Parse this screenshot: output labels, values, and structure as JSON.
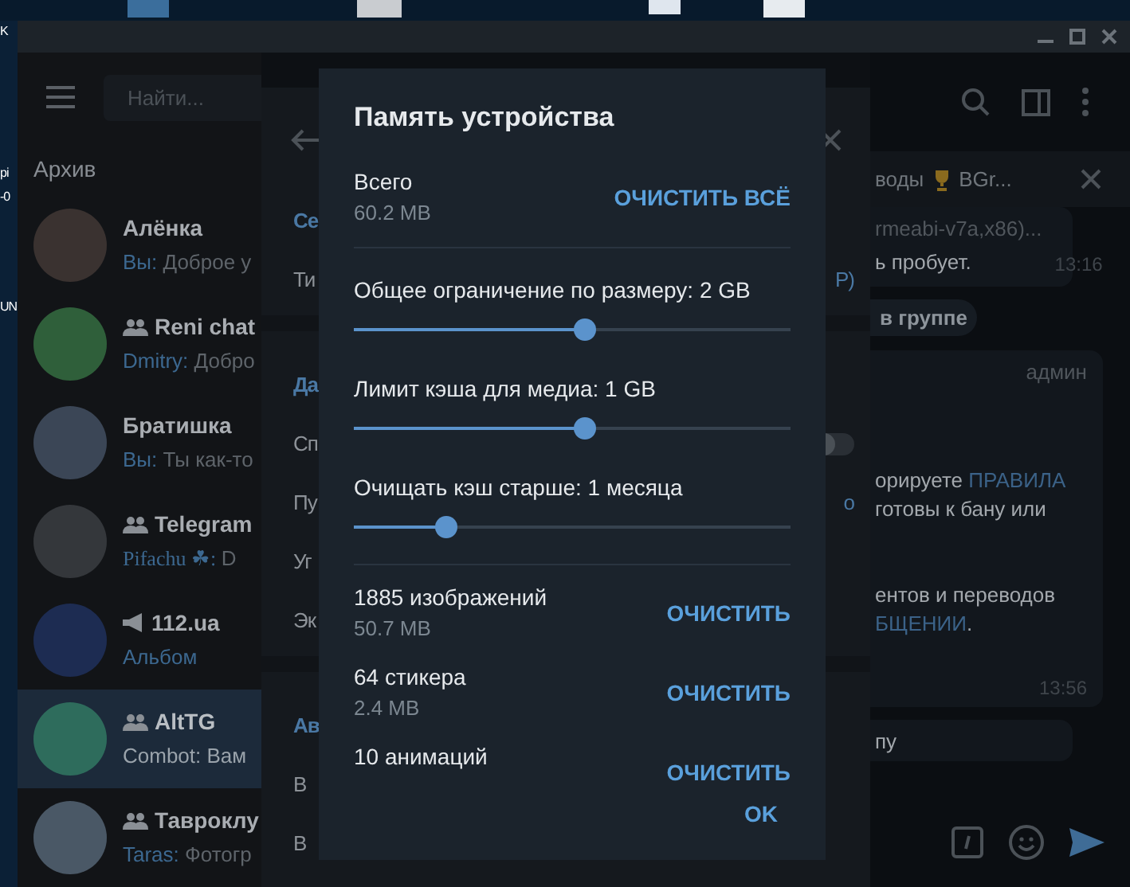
{
  "desktop": {
    "labels": [
      "K",
      "рі",
      "-0",
      "UN"
    ]
  },
  "sidebar": {
    "search": {
      "placeholder": "Найти..."
    },
    "folder_title": "Архив",
    "chats": [
      {
        "name": "Алёнка",
        "kind": "user",
        "sender": "Вы:",
        "preview": "Доброе у",
        "media": false,
        "selected": false
      },
      {
        "name": "Reni chat",
        "kind": "group",
        "sender": "Dmitry:",
        "preview": "Добро",
        "media": false,
        "selected": false
      },
      {
        "name": "Братишка",
        "kind": "user",
        "sender": "Вы:",
        "preview": "Ты как-то",
        "media": false,
        "selected": false
      },
      {
        "name": "Telegram",
        "kind": "group",
        "sender": "Pifachu ☘:",
        "preview": "D",
        "media": false,
        "selected": false
      },
      {
        "name": "112.ua",
        "kind": "channel",
        "preview": "Альбом",
        "media": true,
        "selected": false
      },
      {
        "name": "AltTG",
        "kind": "group",
        "sender": "Combot:",
        "preview": "Вам",
        "media": false,
        "selected": true
      },
      {
        "name": "Тавроклу",
        "kind": "group",
        "sender": "Taras:",
        "preview": "Фотогр",
        "media": false,
        "selected": false
      }
    ]
  },
  "settings_panel": {
    "rows": [
      {
        "kind": "section",
        "label": "Се"
      },
      {
        "kind": "item",
        "label": "Ти",
        "value": "Р)"
      },
      {
        "kind": "section",
        "label": "Да"
      },
      {
        "kind": "toggle",
        "label": "Сп",
        "on": false
      },
      {
        "kind": "item",
        "label": "Пу",
        "value": "о"
      },
      {
        "kind": "item",
        "label": "Уг"
      },
      {
        "kind": "item",
        "label": "Эк"
      },
      {
        "kind": "section",
        "label": "Ав"
      },
      {
        "kind": "item",
        "label": "В"
      },
      {
        "kind": "item",
        "label": "В"
      }
    ]
  },
  "dialog": {
    "title": "Память устройства",
    "total": {
      "label": "Всего",
      "value": "60.2 MB",
      "action": "ОЧИСТИТЬ ВСЁ"
    },
    "sliders": [
      {
        "label": "Общее ограничение по размеру: 2 GB",
        "level": 0.53
      },
      {
        "label": "Лимит кэша для медиа: 1 GB",
        "level": 0.53
      },
      {
        "label": "Очищать кэш старше: 1 месяца",
        "level": 0.21
      }
    ],
    "items": [
      {
        "label": "1885 изображений",
        "size": "50.7 MB",
        "action": "ОЧИСТИТЬ"
      },
      {
        "label": "64 стикера",
        "size": "2.4 MB",
        "action": "ОЧИСТИТЬ"
      },
      {
        "label": "10 анимаций",
        "action": "ОЧИСТИТЬ"
      }
    ],
    "ok": "OK"
  },
  "chat": {
    "pinned": {
      "text": "воды",
      "title": "BGr..."
    },
    "messages": [
      {
        "kind": "bubble",
        "paragraphs": [
          [
            [
              {
                "text": "rmeabi-v7a,x86)...",
                "muted": true
              }
            ],
            [
              {
                "text": "ь пробует."
              }
            ]
          ]
        ],
        "time": "13:16"
      },
      {
        "kind": "service",
        "text": "в группе"
      },
      {
        "kind": "bubble",
        "badge": "админ",
        "paragraphs": [
          [
            [
              {
                "text": "орируете "
              },
              {
                "text": "ПРАВИЛА",
                "link": true
              }
            ],
            [
              {
                "text": "готовы к бану или"
              }
            ]
          ],
          [
            [
              {
                "text": "ентов и переводов"
              }
            ],
            [
              {
                "text": "БЩЕНИИ",
                "link": true
              },
              {
                "text": "."
              }
            ]
          ]
        ],
        "time": "13:56"
      },
      {
        "kind": "bubble",
        "paragraphs": [
          [
            [
              {
                "text": "пу"
              }
            ]
          ]
        ]
      }
    ]
  }
}
